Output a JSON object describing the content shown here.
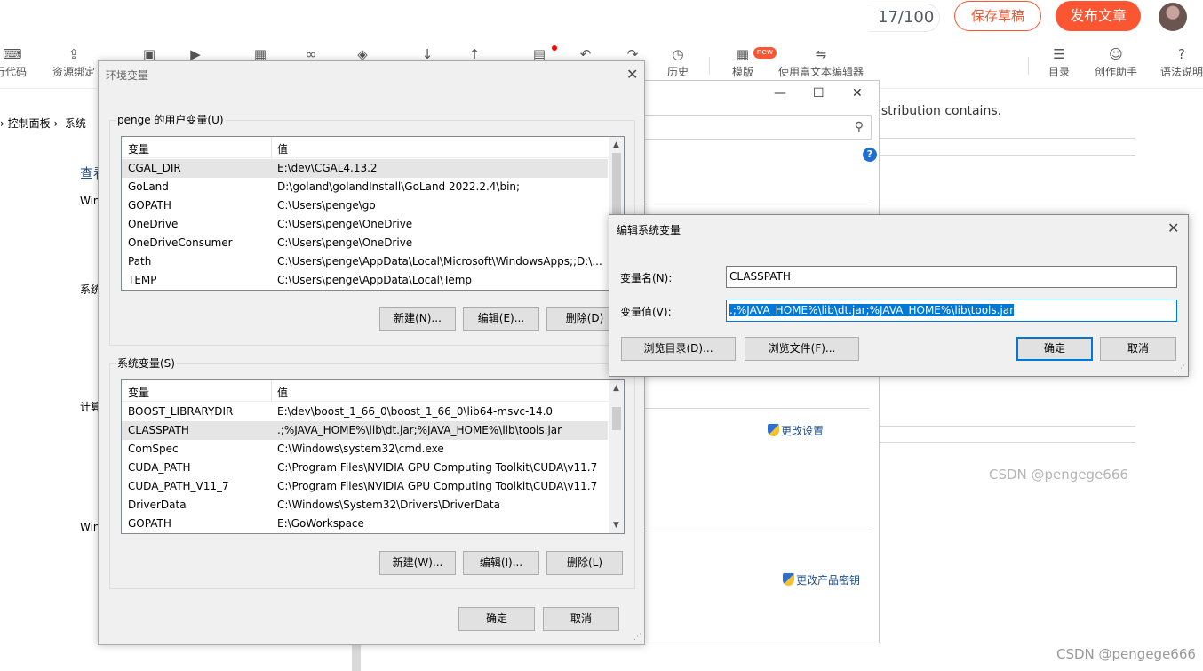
{
  "editor": {
    "word_count": "17/100",
    "save_draft": "保存草稿",
    "publish": "发布文章",
    "toolbar": [
      {
        "name": "insert-code",
        "label": "行代码",
        "icon": "⌨"
      },
      {
        "name": "resource-bind",
        "label": "资源绑定",
        "icon": "⇪"
      },
      {
        "name": "image",
        "label": "",
        "icon": "▣"
      },
      {
        "name": "video",
        "label": "",
        "icon": "▶"
      },
      {
        "name": "table",
        "label": "",
        "icon": "▦"
      },
      {
        "name": "link",
        "label": "",
        "icon": "∞"
      },
      {
        "name": "eraser",
        "label": "",
        "icon": "◈"
      },
      {
        "name": "download",
        "label": "",
        "icon": "↓"
      },
      {
        "name": "upload",
        "label": "",
        "icon": "↑"
      },
      {
        "name": "save",
        "label": "",
        "icon": "▤"
      },
      {
        "name": "undo",
        "label": "",
        "icon": "↶"
      },
      {
        "name": "redo",
        "label": "",
        "icon": "↷"
      },
      {
        "name": "history",
        "label": "历史",
        "icon": "◷"
      },
      {
        "name": "template",
        "label": "模版",
        "icon": "▦"
      },
      {
        "name": "rich-text",
        "label": "使用富文本编辑器",
        "icon": "⇋"
      },
      {
        "name": "toc",
        "label": "目录",
        "icon": "☰"
      },
      {
        "name": "assistant",
        "label": "创作助手",
        "icon": "☺"
      },
      {
        "name": "grammar",
        "label": "语法说明",
        "icon": "?"
      }
    ],
    "new_badge": "new",
    "right_text": "istribution contains.",
    "watermark": "CSDN @pengege666"
  },
  "control_panel": {
    "breadcrumb_a": "控制面板",
    "breadcrumb_b": "系统",
    "view_heading": "查看",
    "side_labels": [
      "Win",
      "系统",
      "计算",
      "Win"
    ],
    "change_settings": "更改设置",
    "change_product_key": "更改产品密钥"
  },
  "env_dialog": {
    "title": "环境变量",
    "user_group": "penge 的用户变量(U)",
    "col_var": "变量",
    "col_val": "值",
    "user_vars": [
      {
        "name": "CGAL_DIR",
        "value": "E:\\dev\\CGAL4.13.2"
      },
      {
        "name": "GoLand",
        "value": "D:\\goland\\golandInstall\\GoLand 2022.2.4\\bin;"
      },
      {
        "name": "GOPATH",
        "value": "C:\\Users\\penge\\go"
      },
      {
        "name": "OneDrive",
        "value": "C:\\Users\\penge\\OneDrive"
      },
      {
        "name": "OneDriveConsumer",
        "value": "C:\\Users\\penge\\OneDrive"
      },
      {
        "name": "Path",
        "value": "C:\\Users\\penge\\AppData\\Local\\Microsoft\\WindowsApps;;D:\\..."
      },
      {
        "name": "TEMP",
        "value": "C:\\Users\\penge\\AppData\\Local\\Temp"
      }
    ],
    "user_buttons": {
      "new": "新建(N)...",
      "edit": "编辑(E)...",
      "delete": "删除(D)"
    },
    "system_group": "系统变量(S)",
    "system_vars": [
      {
        "name": "BOOST_LIBRARYDIR",
        "value": "E:\\dev\\boost_1_66_0\\boost_1_66_0\\lib64-msvc-14.0"
      },
      {
        "name": "CLASSPATH",
        "value": ".;%JAVA_HOME%\\lib\\dt.jar;%JAVA_HOME%\\lib\\tools.jar"
      },
      {
        "name": "ComSpec",
        "value": "C:\\Windows\\system32\\cmd.exe"
      },
      {
        "name": "CUDA_PATH",
        "value": "C:\\Program Files\\NVIDIA GPU Computing Toolkit\\CUDA\\v11.7"
      },
      {
        "name": "CUDA_PATH_V11_7",
        "value": "C:\\Program Files\\NVIDIA GPU Computing Toolkit\\CUDA\\v11.7"
      },
      {
        "name": "DriverData",
        "value": "C:\\Windows\\System32\\Drivers\\DriverData"
      },
      {
        "name": "GOPATH",
        "value": "E:\\GoWorkspace"
      }
    ],
    "system_buttons": {
      "new": "新建(W)...",
      "edit": "编辑(I)...",
      "delete": "删除(L)"
    },
    "ok": "确定",
    "cancel": "取消"
  },
  "edit_dialog": {
    "title": "编辑系统变量",
    "name_label": "变量名(N):",
    "name_value": "CLASSPATH",
    "value_label": "变量值(V):",
    "value_value": ".;%JAVA_HOME%\\lib\\dt.jar;%JAVA_HOME%\\lib\\tools.jar",
    "browse_dir": "浏览目录(D)...",
    "browse_file": "浏览文件(F)...",
    "ok": "确定",
    "cancel": "取消"
  }
}
